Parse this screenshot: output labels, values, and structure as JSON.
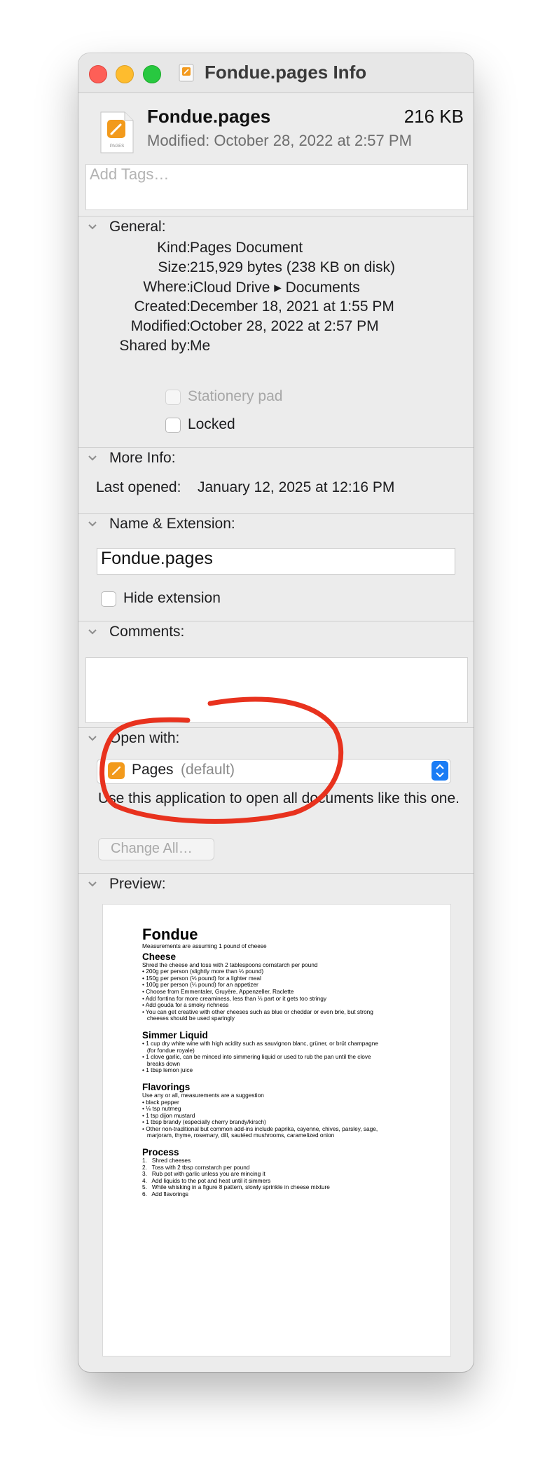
{
  "window": {
    "title": "Fondue.pages Info"
  },
  "header": {
    "file_name": "Fondue.pages",
    "file_size": "216 KB",
    "modified": "Modified: October 28, 2022 at 2:57 PM",
    "tags_placeholder": "Add Tags…"
  },
  "general": {
    "title": "General:",
    "rows": [
      {
        "key": "Kind:",
        "value": "Pages Document"
      },
      {
        "key": "Size:",
        "value": "215,929 bytes (238 KB on disk)"
      },
      {
        "key": "Where:",
        "value": "iCloud Drive ▸ Documents"
      },
      {
        "key": "Created:",
        "value": "December 18, 2021 at 1:55 PM"
      },
      {
        "key": "Modified:",
        "value": "October 28, 2022 at 2:57 PM"
      },
      {
        "key": "Shared by:",
        "value": "Me"
      }
    ],
    "stationery_label": "Stationery pad",
    "locked_label": "Locked"
  },
  "more_info": {
    "title": "More Info:",
    "last_opened_key": "Last opened:",
    "last_opened_value": "January 12, 2025 at 12:16 PM"
  },
  "name_ext": {
    "title": "Name & Extension:",
    "name_value": "Fondue.pages",
    "hide_extension_label": "Hide extension"
  },
  "comments": {
    "title": "Comments:"
  },
  "open_with": {
    "title": "Open with:",
    "app": "Pages",
    "default_suffix": "(default)",
    "description": "Use this application to open all documents like this one.",
    "change_all_label": "Change All…"
  },
  "preview": {
    "title": "Preview:",
    "doc": {
      "title": "Fondue",
      "subtitle": "Measurements are assuming 1 pound of cheese",
      "cheese_heading": "Cheese",
      "cheese_body": "Shred the cheese and toss with 2 tablespoons cornstarch per pound\n• 200g per person (slightly more than ⅓ pound)\n• 150g per person (⅓ pound) for a lighter meal\n• 100g per person (¼ pound) for an appetizer\n• Choose from Emmentaler, Gruyère, Appenzeller, Raclette\n• Add fontina for more creaminess, less than ⅓ part or it gets too stringy\n• Add gouda for a smoky richness\n• You can get creative with other cheeses such as blue or cheddar or even brie, but strong\n   cheeses should be used sparingly",
      "simmer_heading": "Simmer Liquid",
      "simmer_body": "• 1 cup dry white wine with high acidity such as sauvignon blanc, grüner, or brüt champagne\n   (for fondue royale)\n• 1 clove garlic, can be minced into simmering liquid or used to rub the pan until the clove\n   breaks down\n• 1 tbsp lemon juice",
      "flavorings_heading": "Flavorings",
      "flavorings_body": "Use any or all, measurements are a suggestion\n• black pepper\n• ⅛ tsp nutmeg\n• 1 tsp dijon mustard\n• 1 tbsp brandy (especially cherry brandy/kirsch)\n• Other non-traditional but common add-ins include paprika, cayenne, chives, parsley, sage,\n   marjoram, thyme, rosemary, dill, sautéed mushrooms, caramelized onion",
      "process_heading": "Process",
      "process_body": "1.   Shred cheeses\n2.   Toss with 2 tbsp cornstarch per pound\n3.   Rub pot with garlic unless you are mincing it\n4.   Add liquids to the pot and heat until it simmers\n5.   While whisking in a figure 8 pattern, slowly sprinkle in cheese mixture\n6.   Add flavorings"
    }
  },
  "colors": {
    "accent": "#1a7cf5",
    "annotation": "#e8321e",
    "window_bg": "#ececec"
  }
}
